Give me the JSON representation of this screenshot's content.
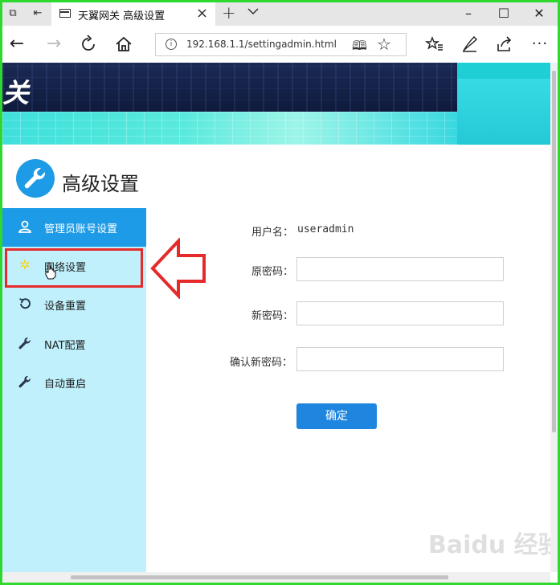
{
  "browser": {
    "tab_title": "天翼网关 高级设置",
    "address": "192.168.1.1/settingadmin.html",
    "new_tab_symbol": "+",
    "window_controls": [
      "minimize-icon",
      "maximize-icon",
      "close-icon"
    ]
  },
  "banner": {
    "logo_text": "关"
  },
  "header": {
    "title": "高级设置",
    "icon": "wrench-icon"
  },
  "sidebar": {
    "items": [
      {
        "label": "管理员账号设置",
        "icon": "user-icon",
        "active": true
      },
      {
        "label": "网络设置",
        "icon": "gear-icon",
        "active": false
      },
      {
        "label": "设备重置",
        "icon": "reset-icon",
        "active": false
      },
      {
        "label": "NAT配置",
        "icon": "wrench-icon",
        "active": false
      },
      {
        "label": "自动重启",
        "icon": "wrench-icon",
        "active": false
      }
    ]
  },
  "form": {
    "username_label": "用户名：",
    "username_value": "useradmin",
    "old_password_label": "原密码：",
    "new_password_label": "新密码：",
    "confirm_password_label": "确认新密码：",
    "submit_label": "确定"
  },
  "watermark": "Baidu 经验",
  "colors": {
    "accent": "#1e9be6",
    "sidebar_bg": "#bff0fb",
    "highlight": "#e52a2a",
    "button": "#1f86e0"
  }
}
